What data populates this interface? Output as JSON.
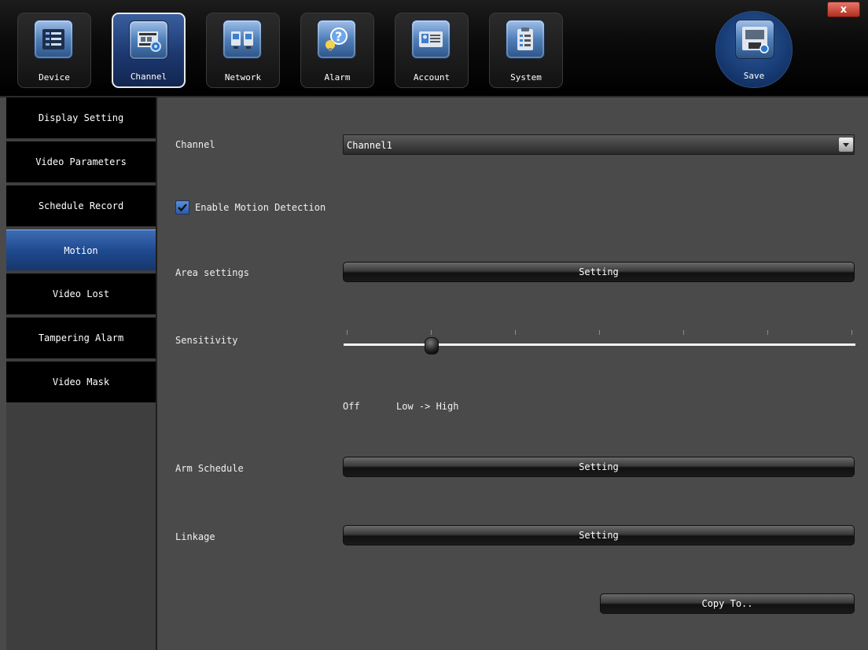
{
  "window": {
    "close_label": "x"
  },
  "tabs": [
    {
      "label": "Device",
      "icon": "device-list-icon",
      "active": false
    },
    {
      "label": "Channel",
      "icon": "film-gear-icon",
      "active": true
    },
    {
      "label": "Network",
      "icon": "network-computers-icon",
      "active": false
    },
    {
      "label": "Alarm",
      "icon": "alarm-question-icon",
      "active": false
    },
    {
      "label": "Account",
      "icon": "account-card-icon",
      "active": false
    },
    {
      "label": "System",
      "icon": "system-clipboard-icon",
      "active": false
    }
  ],
  "save": {
    "label": "Save",
    "icon": "floppy-disk-icon"
  },
  "sidebar": {
    "items": [
      {
        "label": "Display Setting",
        "active": false
      },
      {
        "label": "Video Parameters",
        "active": false
      },
      {
        "label": "Schedule Record",
        "active": false
      },
      {
        "label": "Motion",
        "active": true
      },
      {
        "label": "Video Lost",
        "active": false
      },
      {
        "label": "Tampering Alarm",
        "active": false
      },
      {
        "label": "Video Mask",
        "active": false
      }
    ]
  },
  "form": {
    "channel_label": "Channel",
    "channel_value": "Channel1",
    "enable_motion_label": "Enable Motion Detection",
    "enable_motion_checked": true,
    "area_label": "Area settings",
    "area_button": "Setting",
    "sensitivity_label": "Sensitivity",
    "sensitivity_level_index": 1,
    "sensitivity_levels_count": 7,
    "sensitivity_off": "Off",
    "sensitivity_range": "Low -> High",
    "arm_label": "Arm Schedule",
    "arm_button": "Setting",
    "linkage_label": "Linkage",
    "linkage_button": "Setting",
    "copy_button": "Copy To.."
  },
  "colors": {
    "active_blue": "#1f4a8f",
    "background": "#4a4a4a",
    "sidebar_item": "#000000"
  }
}
